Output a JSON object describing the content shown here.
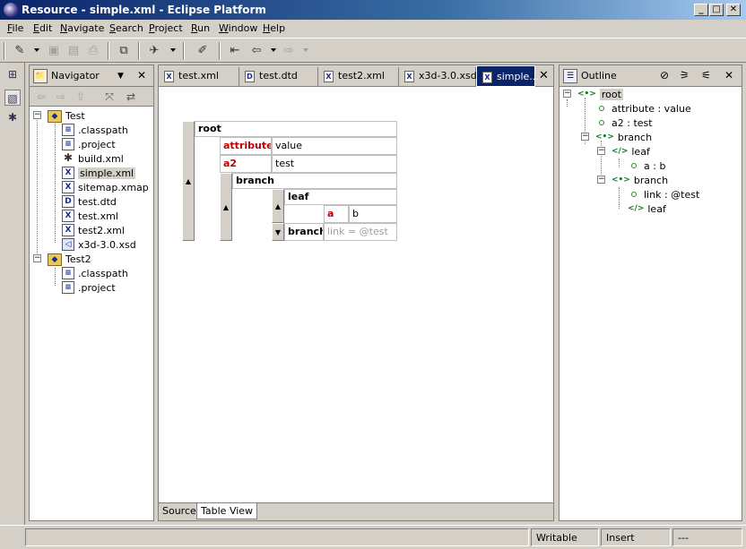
{
  "window": {
    "title": "Resource - simple.xml - Eclipse Platform",
    "min_label": "_",
    "max_label": "□",
    "close_label": "✕"
  },
  "menu": [
    "File",
    "Edit",
    "Navigate",
    "Search",
    "Project",
    "Run",
    "Window",
    "Help"
  ],
  "toolbar": {
    "icons": [
      "new-wizard-icon",
      "save-icon",
      "save-all-icon",
      "print-icon",
      "open-type-icon",
      "run-icon",
      "search-icon",
      "last-edit-icon",
      "back-icon",
      "forward-icon"
    ]
  },
  "shortcuts": [
    "open-perspective-icon",
    "resource-perspective-icon",
    "debug-perspective-icon"
  ],
  "navigator": {
    "title": "Navigator",
    "menu_glyph": "▼",
    "close_glyph": "✕",
    "tree": [
      {
        "label": "Test",
        "kind": "folder"
      },
      {
        "label": ".classpath",
        "kind": "file"
      },
      {
        "label": ".project",
        "kind": "file"
      },
      {
        "label": "build.xml",
        "kind": "ant"
      },
      {
        "label": "simple.xml",
        "kind": "xml"
      },
      {
        "label": "sitemap.xmap",
        "kind": "xml"
      },
      {
        "label": "test.dtd",
        "kind": "dtd"
      },
      {
        "label": "test.xml",
        "kind": "xml"
      },
      {
        "label": "test2.xml",
        "kind": "xml"
      },
      {
        "label": "x3d-3.0.xsd",
        "kind": "xsd"
      },
      {
        "label": "Test2",
        "kind": "folder"
      },
      {
        "label": ".classpath",
        "kind": "file"
      },
      {
        "label": ".project",
        "kind": "file"
      }
    ]
  },
  "editor": {
    "tabs": [
      {
        "label": "test.xml",
        "icon": "X"
      },
      {
        "label": "test.dtd",
        "icon": "D"
      },
      {
        "label": "test2.xml",
        "icon": "X"
      },
      {
        "label": "x3d-3.0.xsd",
        "icon": "X"
      },
      {
        "label": "simple...",
        "icon": "X"
      }
    ],
    "close_glyph": "✕",
    "table": {
      "root": "root",
      "attr1_name": "attribute",
      "attr1_value": "value",
      "attr2_name": "a2",
      "attr2_value": "test",
      "branch": "branch",
      "leaf": "leaf",
      "leaf_attr_name": "a",
      "leaf_attr_value": "b",
      "inner_branch": "branch",
      "inner_branch_value": "link = @test"
    },
    "bottom_tabs": [
      "Source",
      "Table View"
    ]
  },
  "outline": {
    "title": "Outline",
    "close_glyph": "✕",
    "nodes": {
      "root": "root",
      "attr1": "attribute : value",
      "attr2": "a2 : test",
      "branch": "branch",
      "leaf": "leaf",
      "leaf_attr": "a : b",
      "branch2": "branch",
      "link": "link : @test",
      "leaf2": "leaf"
    },
    "elem_glyph": "<•>",
    "elem_empty_glyph": "</>"
  },
  "status": {
    "writable": "Writable",
    "insert": "Insert",
    "position": "---"
  }
}
